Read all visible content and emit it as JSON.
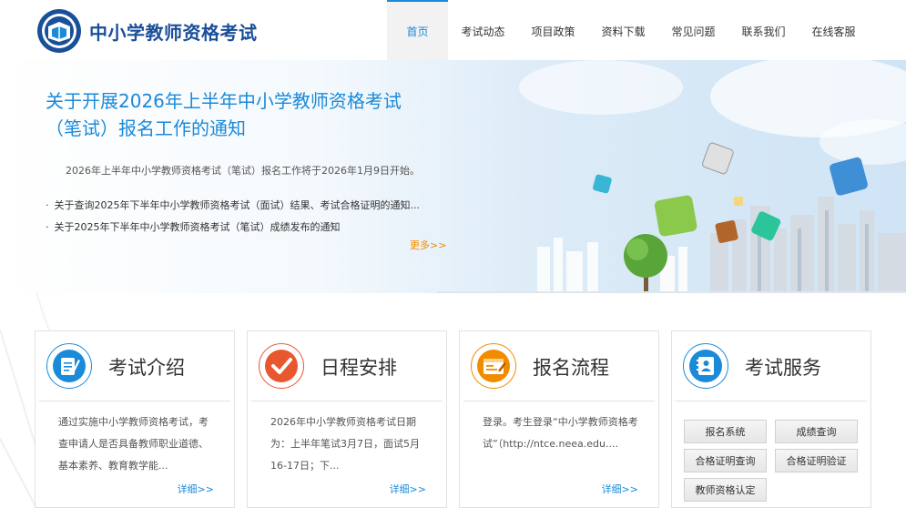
{
  "header": {
    "site_title": "中小学教师资格考试",
    "nav": [
      {
        "label": "首页",
        "active": true
      },
      {
        "label": "考试动态"
      },
      {
        "label": "项目政策"
      },
      {
        "label": "资料下载"
      },
      {
        "label": "常见问题"
      },
      {
        "label": "联系我们"
      },
      {
        "label": "在线客服"
      }
    ]
  },
  "banner": {
    "headline": "关于开展2026年上半年中小学教师资格考试（笔试）报名工作的通知",
    "summary": "2026年上半年中小学教师资格考试（笔试）报名工作将于2026年1月9日开始。",
    "news": [
      "关于查询2025年下半年中小学教师资格考试（面试）结果、考试合格证明的通知...",
      "关于2025年下半年中小学教师资格考试（笔试）成绩发布的通知"
    ],
    "bullet": "·",
    "more": "更多>>"
  },
  "cards": [
    {
      "title": "考试介绍",
      "icon": "document-pen-icon",
      "color": "#1a8ad9",
      "text": "通过实施中小学教师资格考试，考查申请人是否具备教师职业道德、基本素养、教育教学能...",
      "detail": "详细>>"
    },
    {
      "title": "日程安排",
      "icon": "checkmark-icon",
      "color": "#e8572e",
      "text": "2026年中小学教师资格考试日期为：上半年笔试3月7日，面试5月16-17日；下...",
      "detail": "详细>>"
    },
    {
      "title": "报名流程",
      "icon": "form-icon",
      "color": "#f08c00",
      "text": "登录。考生登录“中小学教师资格考试”（http://ntce.neea.edu....",
      "detail": "详细>>"
    },
    {
      "title": "考试服务",
      "icon": "contact-book-icon",
      "color": "#1a8ad9",
      "buttons": [
        "报名系统",
        "成绩查询",
        "合格证明查询",
        "合格证明验证",
        "教师资格认定"
      ]
    }
  ]
}
